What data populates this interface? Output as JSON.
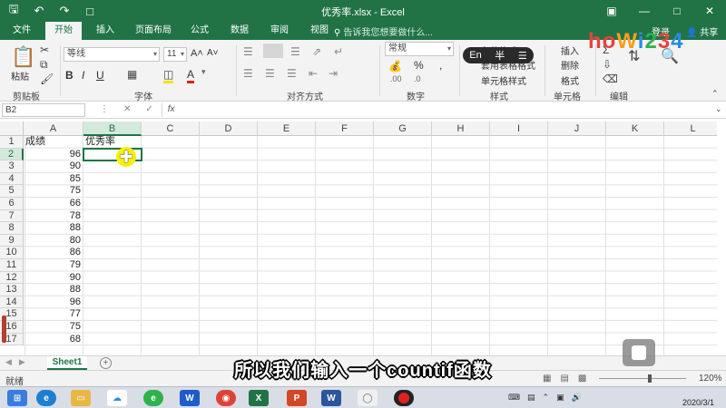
{
  "window": {
    "title": "优秀率.xlsx - Excel",
    "quick_access": [
      "save-icon",
      "undo-icon",
      "redo-icon",
      "new-icon"
    ]
  },
  "ribbon": {
    "tabs": [
      {
        "label": "文件",
        "active": false
      },
      {
        "label": "开始",
        "active": true
      },
      {
        "label": "插入",
        "active": false
      },
      {
        "label": "页面布局",
        "active": false
      },
      {
        "label": "公式",
        "active": false
      },
      {
        "label": "数据",
        "active": false
      },
      {
        "label": "审阅",
        "active": false
      },
      {
        "label": "视图",
        "active": false
      }
    ],
    "tell_me": "告诉我您想要做什么...",
    "sign_in": "登录",
    "share": "共享",
    "font_name": "等线",
    "font_size": "11",
    "number_format": "常规",
    "paste": "粘贴",
    "groups": [
      "剪贴板",
      "字体",
      "对齐方式",
      "数字",
      "样式",
      "单元格",
      "编辑"
    ],
    "conditional_format": "条件格式",
    "format_as_table": "套用表格格式",
    "cell_styles": "单元格样式",
    "insert": "插入",
    "delete": "删除",
    "format": "格式",
    "ime_badge": [
      "En",
      "半"
    ]
  },
  "formula_bar": {
    "name_box": "B2",
    "fx": "fx",
    "formula": ""
  },
  "sheet": {
    "columns": [
      "A",
      "B",
      "C",
      "D",
      "E",
      "F",
      "G",
      "H",
      "I",
      "J",
      "K",
      "L"
    ],
    "rows": [
      "1",
      "2",
      "3",
      "4",
      "5",
      "6",
      "7",
      "8",
      "9",
      "10",
      "11",
      "12",
      "13",
      "14",
      "15",
      "16",
      "17"
    ],
    "cells": {
      "A1": "成绩",
      "B1": "优秀率",
      "A": [
        "96",
        "90",
        "85",
        "75",
        "66",
        "78",
        "88",
        "80",
        "86",
        "79",
        "90",
        "88",
        "96",
        "77",
        "75",
        "68"
      ]
    },
    "selected_cell": "B2",
    "selected_column": "B",
    "selected_row": "2"
  },
  "sheet_tabs": {
    "tabs": [
      "Sheet1"
    ],
    "active": "Sheet1"
  },
  "status": {
    "ready": "就绪",
    "zoom": "120%"
  },
  "subtitle": "所以我们输入一个countif函数",
  "taskbar": {
    "date": "2020/3/1"
  },
  "watermark": {
    "text": "hoWi234"
  }
}
